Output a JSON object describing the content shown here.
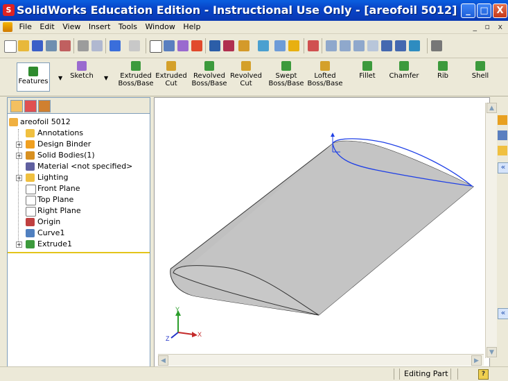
{
  "window": {
    "title": "SolidWorks Education Edition - Instructional Use Only - [areofoil 5012]",
    "minimize": "_",
    "maximize": "□",
    "close": "X"
  },
  "menubar": {
    "items": [
      "File",
      "Edit",
      "View",
      "Insert",
      "Tools",
      "Window",
      "Help"
    ],
    "right_controls": "_ ▫ x"
  },
  "command_manager": {
    "features_tab": "Features",
    "sketch_tab": "Sketch",
    "commands": [
      {
        "l1": "Extruded",
        "l2": "Boss/Base",
        "icon": "extruded-boss-icon"
      },
      {
        "l1": "Extruded",
        "l2": "Cut",
        "icon": "extruded-cut-icon"
      },
      {
        "l1": "Revolved",
        "l2": "Boss/Base",
        "icon": "revolved-boss-icon"
      },
      {
        "l1": "Revolved",
        "l2": "Cut",
        "icon": "revolved-cut-icon"
      },
      {
        "l1": "Swept",
        "l2": "Boss/Base",
        "icon": "swept-boss-icon"
      },
      {
        "l1": "Lofted",
        "l2": "Boss/Base",
        "icon": "lofted-boss-icon"
      },
      {
        "l1": "Fillet",
        "l2": "",
        "icon": "fillet-icon"
      },
      {
        "l1": "Chamfer",
        "l2": "",
        "icon": "chamfer-icon"
      },
      {
        "l1": "Rib",
        "l2": "",
        "icon": "rib-icon"
      },
      {
        "l1": "Shell",
        "l2": "",
        "icon": "shell-icon"
      }
    ]
  },
  "feature_tree": {
    "root": "areofoil 5012",
    "items": [
      {
        "label": "Annotations",
        "icon": "annotations-icon",
        "expandable": false
      },
      {
        "label": "Design Binder",
        "icon": "design-binder-icon",
        "expandable": true
      },
      {
        "label": "Solid Bodies(1)",
        "icon": "solid-bodies-icon",
        "expandable": true
      },
      {
        "label": "Material <not specified>",
        "icon": "material-icon",
        "expandable": false
      },
      {
        "label": "Lighting",
        "icon": "lighting-icon",
        "expandable": true
      },
      {
        "label": "Front Plane",
        "icon": "plane-icon",
        "expandable": false
      },
      {
        "label": "Top Plane",
        "icon": "plane-icon",
        "expandable": false
      },
      {
        "label": "Right Plane",
        "icon": "plane-icon",
        "expandable": false
      },
      {
        "label": "Origin",
        "icon": "origin-icon",
        "expandable": false
      },
      {
        "label": "Curve1",
        "icon": "curve-icon",
        "expandable": false
      },
      {
        "label": "Extrude1",
        "icon": "extrude-icon",
        "expandable": true
      }
    ]
  },
  "triad": {
    "y": "Y",
    "x": "X",
    "z": "Z"
  },
  "statusbar": {
    "mode": "Editing Part",
    "help": "?"
  },
  "colors": {
    "title_blue": "#0845C8",
    "sketch_blue": "#1E3FE6",
    "model_gray": "#C0C0C0",
    "rollback_yellow": "#E3C51A"
  }
}
